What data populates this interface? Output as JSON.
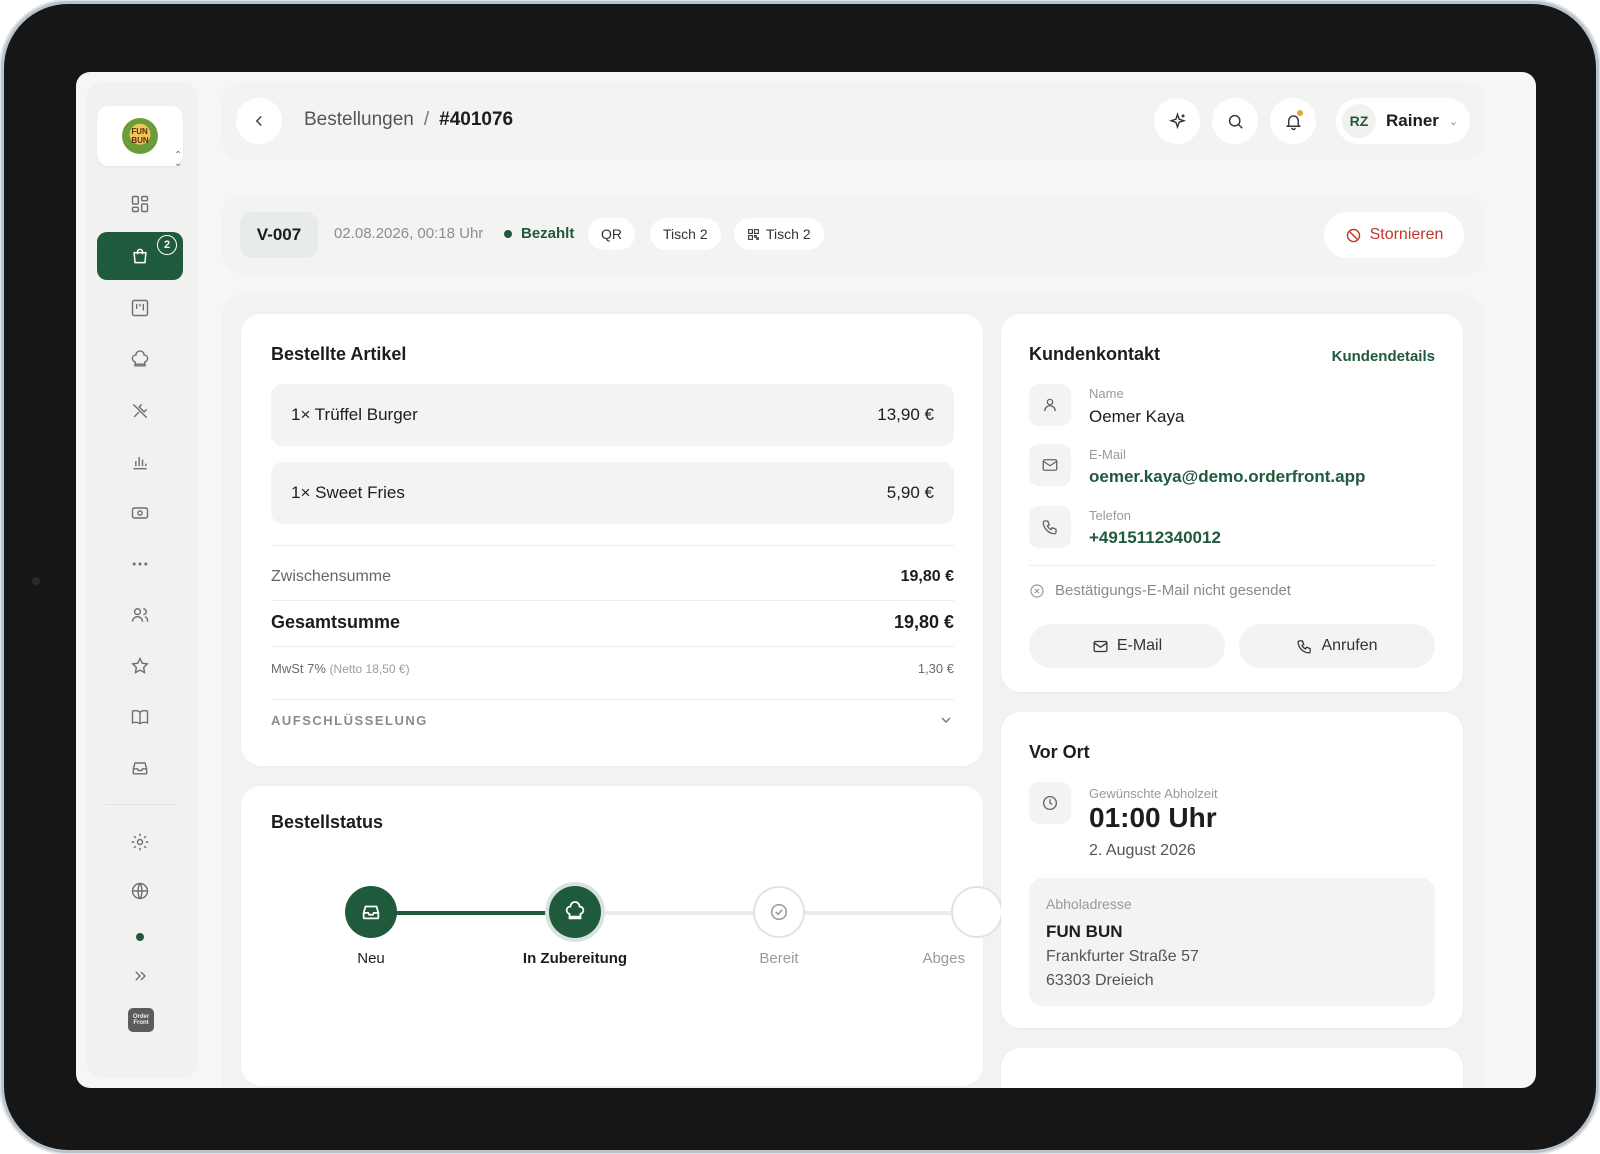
{
  "header": {
    "breadcrumb_parent": "Bestellungen",
    "breadcrumb_separator": "/",
    "breadcrumb_current": "#401076",
    "user_initials": "RZ",
    "user_name": "Rainer"
  },
  "sidebar": {
    "orders_badge": "2"
  },
  "order": {
    "id": "V-007",
    "datetime": "02.08.2026, 00:18 Uhr",
    "payment_status": "Bezahlt",
    "chips": [
      "QR",
      "Tisch 2",
      "Tisch 2"
    ],
    "cancel_label": "Stornieren"
  },
  "items_card": {
    "title": "Bestellte Artikel",
    "items": [
      {
        "name": "1× Trüffel Burger",
        "price": "13,90 €"
      },
      {
        "name": "1× Sweet Fries",
        "price": "5,90 €"
      }
    ],
    "subtotal_label": "Zwischensumme",
    "subtotal_value": "19,80 €",
    "total_label": "Gesamtsumme",
    "total_value": "19,80 €",
    "vat_label": "MwSt 7%",
    "vat_net": "(Netto 18,50 €)",
    "vat_value": "1,30 €",
    "breakdown_label": "AUFSCHLÜSSELUNG"
  },
  "status_card": {
    "title": "Bestellstatus",
    "steps": [
      {
        "label": "Neu",
        "state": "done"
      },
      {
        "label": "In Zubereitung",
        "state": "active"
      },
      {
        "label": "Bereit",
        "state": "todo"
      },
      {
        "label": "Abges",
        "state": "todo"
      }
    ]
  },
  "customer_card": {
    "title": "Kundenkontakt",
    "details_link": "Kundendetails",
    "name_label": "Name",
    "name_value": "Oemer Kaya",
    "email_label": "E-Mail",
    "email_value": "oemer.kaya@demo.orderfront.app",
    "phone_label": "Telefon",
    "phone_value": "+4915112340012",
    "confirmation_text": "Bestätigungs-E-Mail nicht gesendet",
    "email_button": "E-Mail",
    "call_button": "Anrufen"
  },
  "pickup_card": {
    "title": "Vor Ort",
    "time_label": "Gewünschte Abholzeit",
    "time_value": "01:00 Uhr",
    "date_value": "2. August 2026",
    "address_label": "Abholadresse",
    "address_name": "FUN BUN",
    "address_street": "Frankfurter Straße 57",
    "address_city": "63303 Dreieich"
  },
  "colors": {
    "accent": "#1f5a3c",
    "danger": "#c0392b",
    "notification": "#e9a13b"
  }
}
